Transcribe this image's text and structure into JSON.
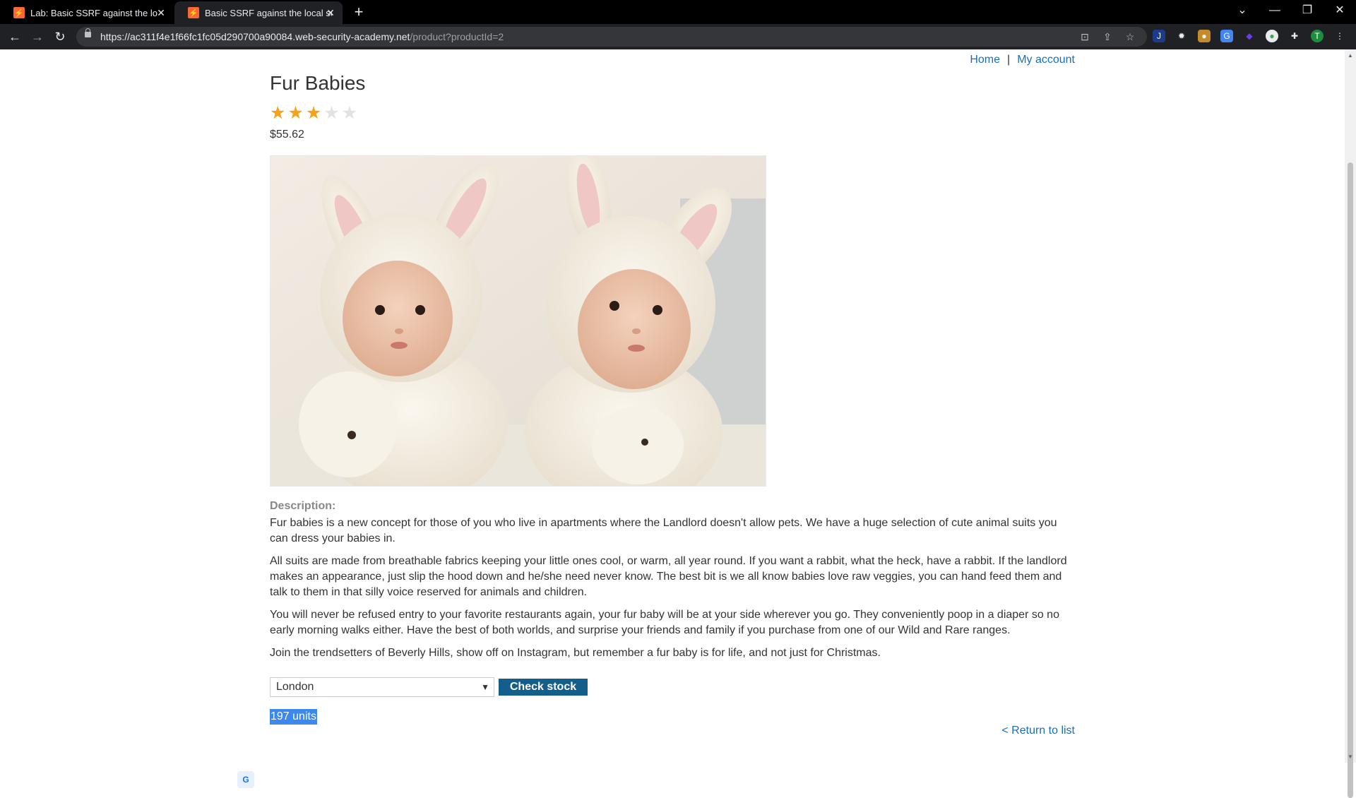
{
  "browser": {
    "tabs": [
      {
        "title": "Lab: Basic SSRF against the local",
        "active": false
      },
      {
        "title": "Basic SSRF against the local serv",
        "active": true
      }
    ],
    "url_host": "https://ac311f4e1f66fc1fc05d290700a90084.web-security-academy.net",
    "url_path": "/product?productId=2",
    "profile_initial": "T"
  },
  "nav": {
    "home": "Home",
    "separator": "|",
    "account": "My account"
  },
  "product": {
    "title": "Fur Babies",
    "rating": 3,
    "rating_max": 5,
    "price": "$55.62",
    "description_label": "Description:",
    "paragraphs": [
      "Fur babies is a new concept for those of you who live in apartments where the Landlord doesn't allow pets. We have a huge selection of cute animal suits you can dress your babies in.",
      "All suits are made from breathable fabrics keeping your little ones cool, or warm, all year round. If you want a rabbit, what the heck, have a rabbit. If the landlord makes an appearance, just slip the hood down and he/she need never know. The best bit is we all know babies love raw veggies, you can hand feed them and talk to them in that silly voice reserved for animals and children.",
      "You will never be refused entry to your favorite restaurants again, your fur baby will be at your side wherever you go. They conveniently poop in a diaper so no early morning walks either. Have the best of both worlds, and surprise your friends and family if you purchase from one of our Wild and Rare ranges.",
      "Join the trendsetters of Beverly Hills, show off on Instagram, but remember a fur baby is for life, and not just for Christmas."
    ]
  },
  "stock": {
    "store": "London",
    "button": "Check stock",
    "result": "197 units"
  },
  "return_link": "< Return to list",
  "colors": {
    "link": "#1a6fb5",
    "button": "#135e8a",
    "star_on": "#f7a21b",
    "star_off": "#dfe3e6",
    "selection": "#3c88ee"
  }
}
